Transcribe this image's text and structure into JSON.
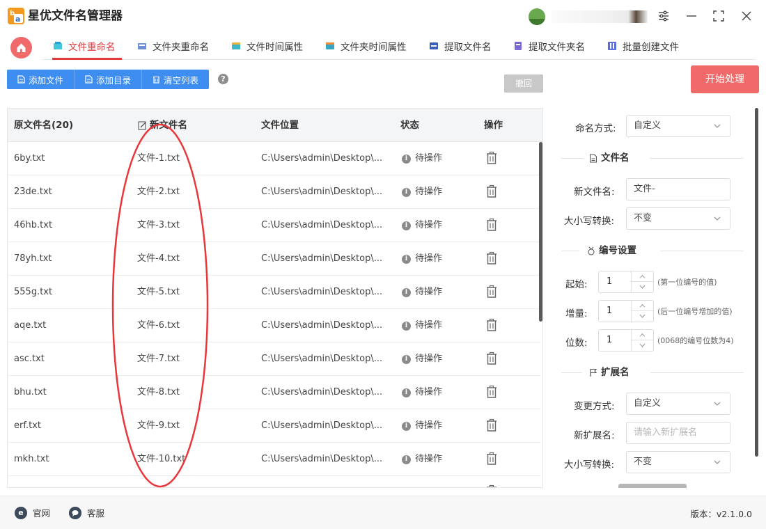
{
  "app": {
    "title": "星优文件名管理器",
    "user_name": " "
  },
  "tabs": [
    {
      "label": "文件重命名",
      "icon": "rename-file-icon",
      "active": true
    },
    {
      "label": "文件夹重命名",
      "icon": "rename-folder-icon"
    },
    {
      "label": "文件时间属性",
      "icon": "file-time-icon"
    },
    {
      "label": "文件夹时间属性",
      "icon": "folder-time-icon"
    },
    {
      "label": "提取文件名",
      "icon": "extract-filename-icon"
    },
    {
      "label": "提取文件夹名",
      "icon": "extract-foldername-icon"
    },
    {
      "label": "批量创建文件",
      "icon": "batch-create-icon"
    }
  ],
  "toolbar": {
    "add_file": "添加文件",
    "add_dir": "添加目录",
    "clear_list": "清空列表",
    "help": "?",
    "undo": "撤回",
    "start": "开始处理"
  },
  "table": {
    "headers": {
      "original": "原文件名(20)",
      "new": "新文件名",
      "location": "文件位置",
      "status": "状态",
      "action": "操作"
    },
    "rows": [
      {
        "original": "6by.txt",
        "new": "文件-1.txt",
        "location": "C:\\Users\\admin\\Desktop\\...",
        "status": "待操作"
      },
      {
        "original": "23de.txt",
        "new": "文件-2.txt",
        "location": "C:\\Users\\admin\\Desktop\\...",
        "status": "待操作"
      },
      {
        "original": "46hb.txt",
        "new": "文件-3.txt",
        "location": "C:\\Users\\admin\\Desktop\\...",
        "status": "待操作"
      },
      {
        "original": "78yh.txt",
        "new": "文件-4.txt",
        "location": "C:\\Users\\admin\\Desktop\\...",
        "status": "待操作"
      },
      {
        "original": "555g.txt",
        "new": "文件-5.txt",
        "location": "C:\\Users\\admin\\Desktop\\...",
        "status": "待操作"
      },
      {
        "original": "aqe.txt",
        "new": "文件-6.txt",
        "location": "C:\\Users\\admin\\Desktop\\...",
        "status": "待操作"
      },
      {
        "original": "asc.txt",
        "new": "文件-7.txt",
        "location": "C:\\Users\\admin\\Desktop\\...",
        "status": "待操作"
      },
      {
        "original": "bhu.txt",
        "new": "文件-8.txt",
        "location": "C:\\Users\\admin\\Desktop\\...",
        "status": "待操作"
      },
      {
        "original": "erf.txt",
        "new": "文件-9.txt",
        "location": "C:\\Users\\admin\\Desktop\\...",
        "status": "待操作"
      },
      {
        "original": "mkh.txt",
        "new": "文件-10.txt",
        "location": "C:\\Users\\admin\\Desktop\\...",
        "status": "待操作"
      }
    ]
  },
  "panel": {
    "naming_mode_label": "命名方式:",
    "naming_mode_value": "自定义",
    "filename_section": "文件名",
    "new_filename_label": "新文件名:",
    "new_filename_value": "文件-",
    "case_label": "大小写转换:",
    "case_value": "不变",
    "numbering_section": "编号设置",
    "start_label": "起始:",
    "start_value": "1",
    "start_hint": "(第一位编号的值)",
    "step_label": "增量:",
    "step_value": "1",
    "step_hint": "(后一位编号增加的值)",
    "digits_label": "位数:",
    "digits_value": "1",
    "digits_hint": "(0068的编号位数为4)",
    "ext_section": "扩展名",
    "ext_mode_label": "变更方式:",
    "ext_mode_value": "自定义",
    "new_ext_label": "新扩展名:",
    "new_ext_placeholder": "请输入新扩展名",
    "ext_case_label": "大小写转换:",
    "ext_case_value": "不变"
  },
  "footer": {
    "website": "官网",
    "support": "客服",
    "version": "版本：v2.1.0.0"
  },
  "colors": {
    "accent": "#e0393e",
    "primary": "#3d8ef0",
    "start": "#f06a6a",
    "annotation": "#e8363b"
  }
}
